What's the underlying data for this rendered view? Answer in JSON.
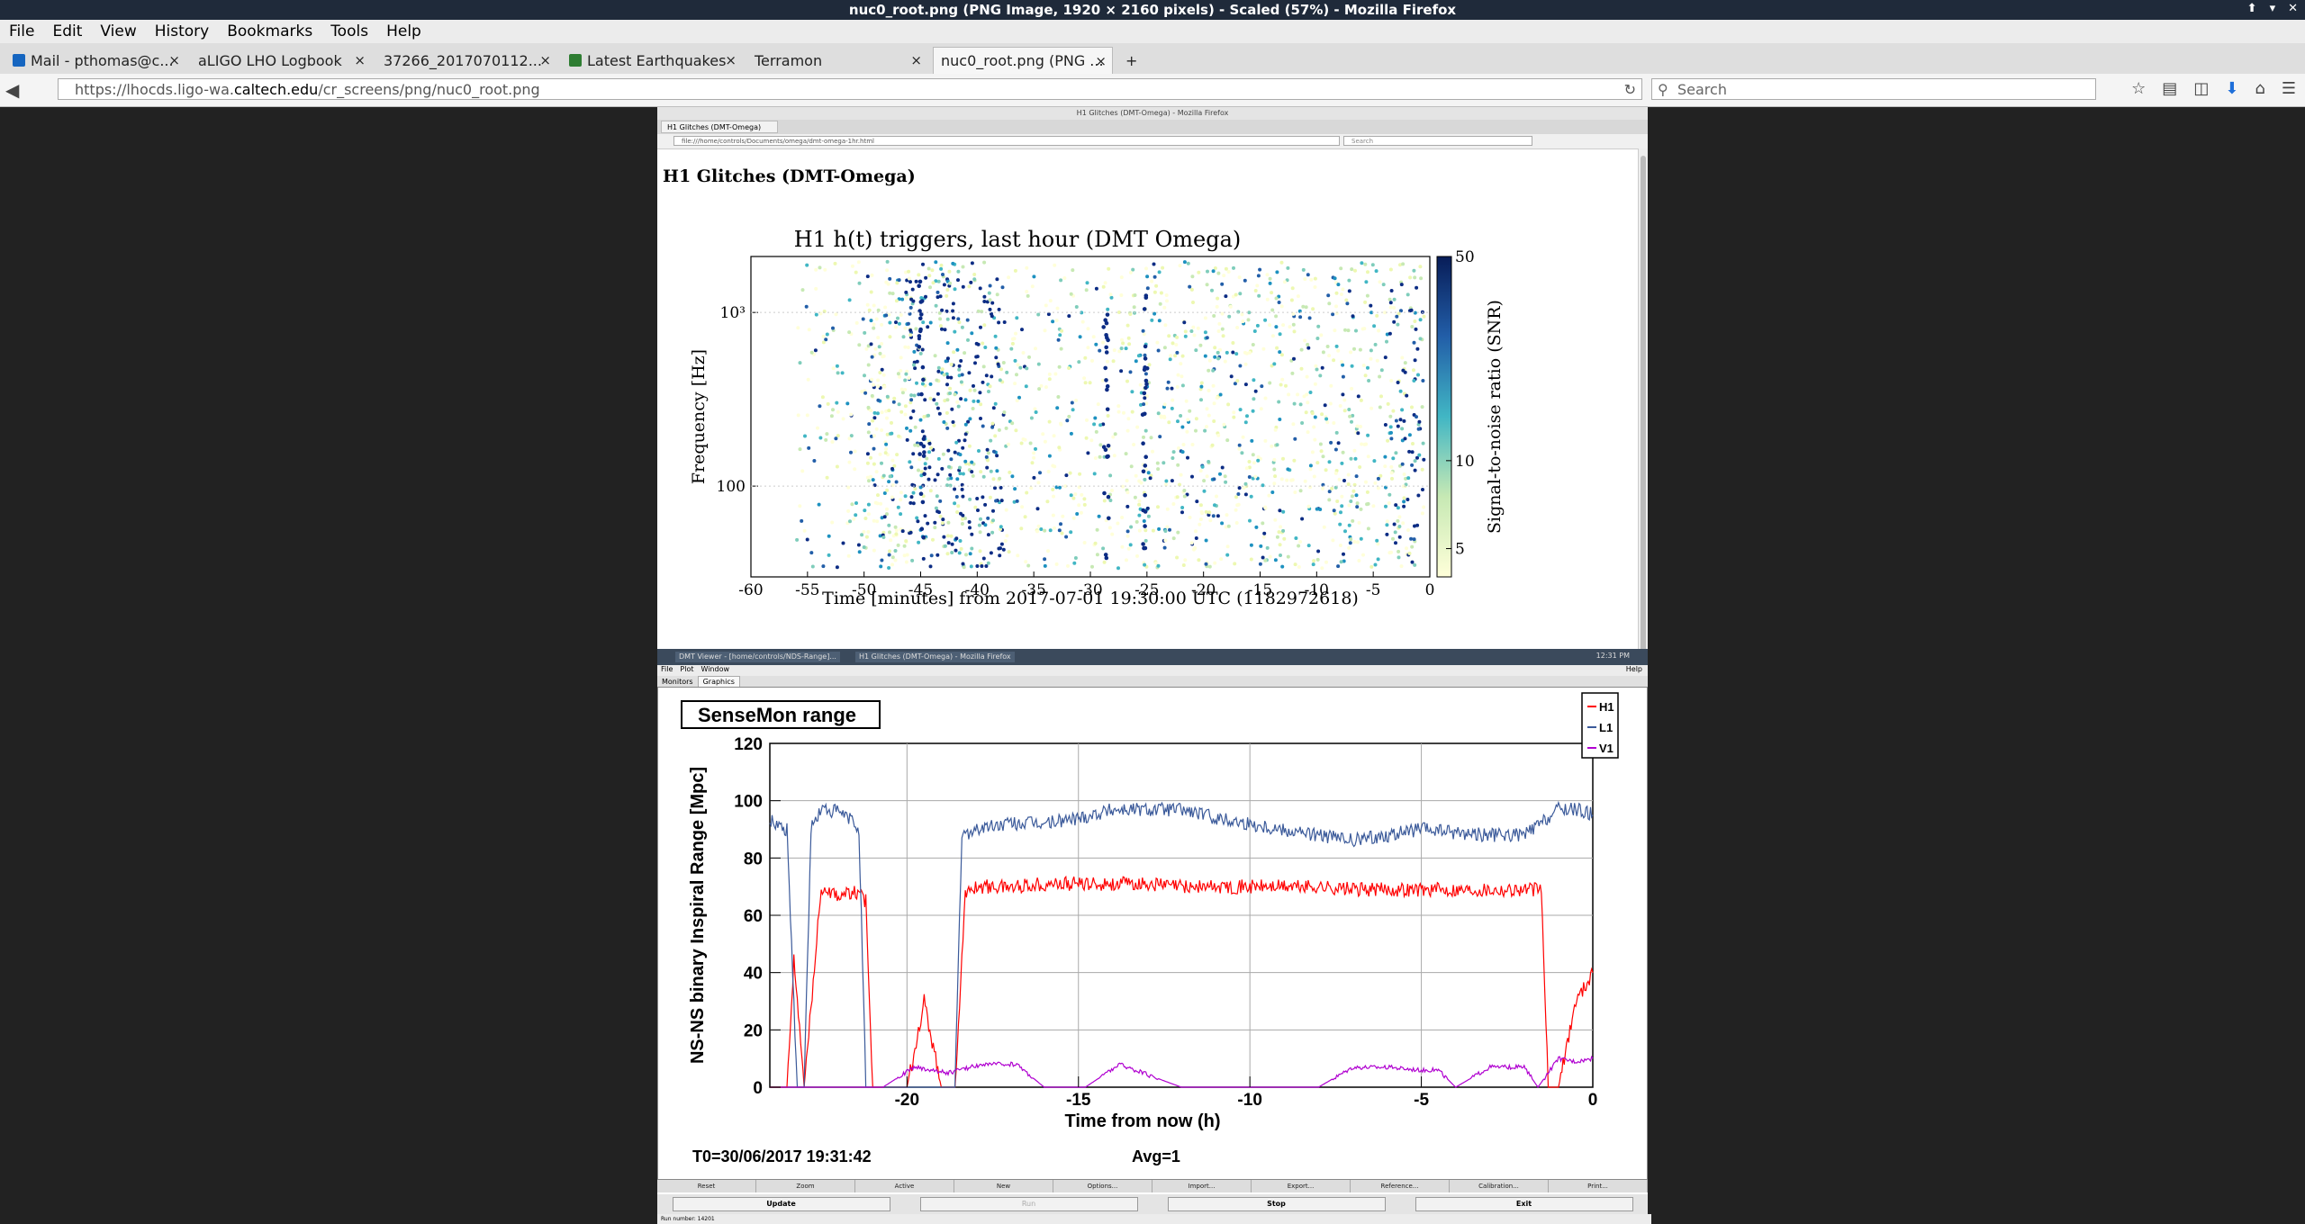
{
  "window": {
    "title": "nuc0_root.png (PNG Image, 1920 × 2160 pixels) - Scaled (57%) - Mozilla Firefox"
  },
  "menu": [
    "File",
    "Edit",
    "View",
    "History",
    "Bookmarks",
    "Tools",
    "Help"
  ],
  "tabs": [
    {
      "label": "Mail - pthomas@c...",
      "icon_color": "#1565c0"
    },
    {
      "label": "aLIGO LHO Logbook",
      "icon_color": ""
    },
    {
      "label": "37266_2017070112...",
      "icon_color": ""
    },
    {
      "label": "Latest Earthquakes",
      "icon_color": "#2e7d32"
    },
    {
      "label": "Terramon",
      "icon_color": ""
    },
    {
      "label": "nuc0_root.png (PNG ...",
      "icon_color": "",
      "active": true
    }
  ],
  "nav": {
    "url_prefix": "https://lhocds.ligo-wa.",
    "url_domain": "caltech.edu",
    "url_path": "/cr_screens/png/nuc0_root.png",
    "search_placeholder": "Search"
  },
  "inner_browser": {
    "title": "H1 Glitches (DMT-Omega) - Mozilla Firefox",
    "tab": "H1 Glitches (DMT-Omega)",
    "url": "file:///home/controls/Documents/omega/dmt-omega-1hr.html",
    "search": "Search"
  },
  "page_heading": "H1 Glitches (DMT-Omega)",
  "omega_chart": {
    "title": "H1 h(t) triggers, last hour (DMT Omega)",
    "xlabel": "Time [minutes] from 2017-07-01 19:30:00 UTC (1182972618)",
    "ylabel": "Frequency [Hz]",
    "colorbar_label": "Signal-to-noise ratio (SNR)",
    "xticks": [
      "-60",
      "-55",
      "-50",
      "-45",
      "-40",
      "-35",
      "-30",
      "-25",
      "-20",
      "-15",
      "-10",
      "-5",
      "0"
    ],
    "yticks": [
      "100",
      "10³"
    ],
    "cticks": [
      "50",
      "10",
      "5"
    ]
  },
  "taskbar": {
    "items": [
      "DMT Viewer - [home/controls/NDS-Range]...",
      "H1 Glitches (DMT-Omega) - Mozilla Firefox"
    ],
    "clock": "12:31 PM"
  },
  "dmt_menu": [
    "File",
    "Plot",
    "Window"
  ],
  "dmt_help": "Help",
  "dmt_tabs": [
    "Monitors",
    "Graphics"
  ],
  "sensemon": {
    "title": "SenseMon range",
    "ylabel": "NS-NS binary Inspiral Range [Mpc]",
    "xlabel": "Time from now (h)",
    "t0": "T0=30/06/2017 19:31:42",
    "avg": "Avg=1",
    "legend": [
      "H1",
      "L1",
      "V1"
    ]
  },
  "dmt_buttons_row1": [
    "Reset",
    "Zoom",
    "Active",
    "New",
    "Options...",
    "Import...",
    "Export...",
    "Reference...",
    "Calibration...",
    "Print..."
  ],
  "dmt_buttons_row2": [
    "Update",
    "Run",
    "Stop",
    "Exit"
  ],
  "dmt_status": "Run number: 14201",
  "chart_data": [
    {
      "type": "scatter",
      "title": "H1 h(t) triggers, last hour (DMT Omega)",
      "xlabel": "Time [minutes] from 2017-07-01 19:30:00 UTC (1182972618)",
      "ylabel": "Frequency [Hz]",
      "xlim": [
        -60,
        0
      ],
      "ylim": [
        30,
        2100
      ],
      "yscale": "log",
      "colorbar": {
        "label": "Signal-to-noise ratio (SNR)",
        "range": [
          4,
          50
        ],
        "scale": "log"
      },
      "note_regions": [
        {
          "x": [
            -46,
            -37.5
          ],
          "y": [
            70,
            2000
          ],
          "snr": "high"
        },
        {
          "x": [
            -25.5,
            -24.8
          ],
          "y": [
            40,
            2000
          ],
          "snr": "very high"
        },
        {
          "x": [
            -4,
            -0.5
          ],
          "y": [
            40,
            1500
          ],
          "snr": "high"
        }
      ]
    },
    {
      "type": "line",
      "title": "SenseMon range",
      "xlabel": "Time from now (h)",
      "ylabel": "NS-NS binary Inspiral Range [Mpc]",
      "xlim": [
        -24,
        0
      ],
      "ylim": [
        0,
        120
      ],
      "series": [
        {
          "name": "H1",
          "color": "#ff0000",
          "x": [
            -24,
            -23.5,
            -23.3,
            -23,
            -22.5,
            -22,
            -21.5,
            -21.2,
            -21,
            -20.5,
            -20,
            -19.5,
            -19,
            -18.6,
            -18.3,
            -18,
            -17,
            -16,
            -15,
            -14,
            -13,
            -12,
            -11,
            -10,
            -9,
            -8,
            -7,
            -6,
            -5,
            -4,
            -3,
            -2,
            -1.5,
            -1.3,
            -1,
            -0.5,
            0
          ],
          "y": [
            0,
            0,
            45,
            0,
            70,
            67,
            68,
            65,
            0,
            0,
            0,
            30,
            0,
            0,
            67,
            70,
            70,
            71,
            71,
            71,
            71,
            70,
            70,
            70,
            70,
            70,
            69,
            69,
            69,
            69,
            69,
            69,
            69,
            0,
            0,
            30,
            40
          ]
        },
        {
          "name": "L1",
          "color": "#3b5a9a",
          "x": [
            -24,
            -23.5,
            -23.2,
            -23,
            -22.8,
            -22.5,
            -22,
            -21.6,
            -21.4,
            -21.2,
            -21,
            -20,
            -19,
            -18.6,
            -18.4,
            -18,
            -17,
            -16,
            -15,
            -14,
            -13,
            -12,
            -11,
            -10,
            -9,
            -8,
            -7,
            -6,
            -5,
            -4,
            -3,
            -2,
            -1.5,
            -1,
            -0.5,
            0
          ],
          "y": [
            93,
            90,
            0,
            0,
            90,
            97,
            96,
            93,
            90,
            0,
            0,
            0,
            0,
            0,
            88,
            90,
            92,
            92,
            94,
            97,
            97,
            97,
            94,
            92,
            90,
            88,
            86,
            88,
            90,
            89,
            88,
            88,
            92,
            97,
            97,
            95
          ]
        },
        {
          "name": "V1",
          "color": "#b000d0",
          "x": [
            -24,
            -21,
            -20.7,
            -19.8,
            -18.8,
            -17.8,
            -16.8,
            -16,
            -15.8,
            -14.8,
            -13.8,
            -12,
            -11,
            -10,
            -9,
            -8,
            -7,
            -6,
            -5,
            -4.5,
            -4,
            -3,
            -2,
            -1.6,
            -1,
            -0.5,
            0
          ],
          "y": [
            0,
            0,
            0,
            7,
            5,
            8,
            8,
            0,
            0,
            0,
            8,
            0,
            0,
            0,
            0,
            0,
            7,
            7,
            6,
            6,
            0,
            7,
            7,
            0,
            10,
            9,
            10
          ]
        }
      ]
    }
  ]
}
